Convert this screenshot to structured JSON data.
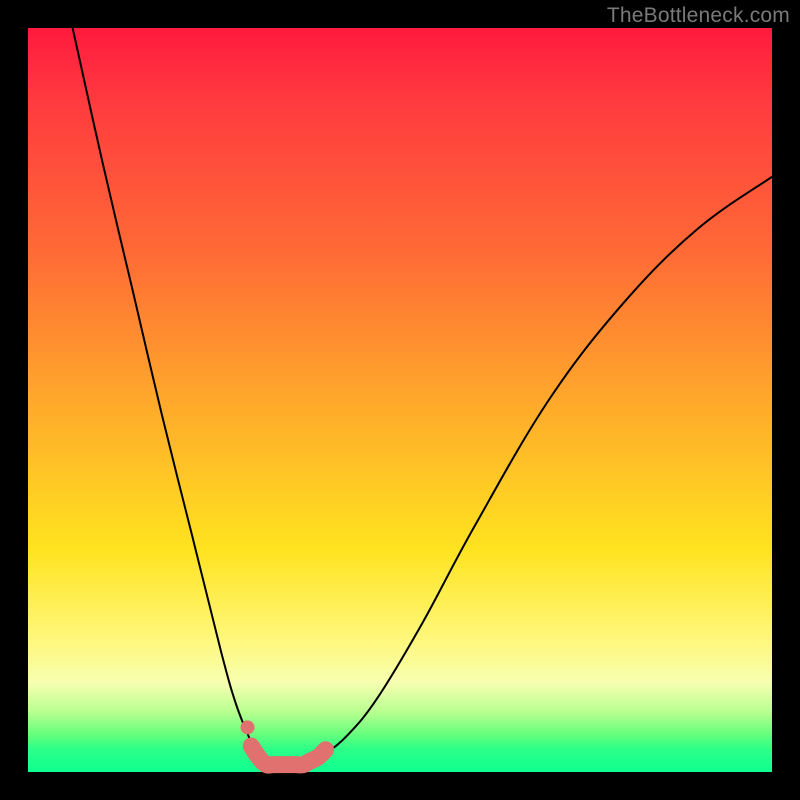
{
  "watermark": {
    "text": "TheBottleneck.com"
  },
  "chart_data": {
    "type": "line",
    "title": "",
    "xlabel": "",
    "ylabel": "",
    "xlim": [
      0,
      100
    ],
    "ylim": [
      0,
      100
    ],
    "series": [
      {
        "name": "black-curve",
        "x": [
          6,
          10,
          14,
          18,
          22,
          26,
          28,
          30,
          31,
          32,
          33,
          34,
          35,
          36,
          38,
          40,
          43,
          47,
          53,
          60,
          70,
          80,
          90,
          100
        ],
        "y": [
          100,
          82,
          65,
          48,
          32,
          16,
          9,
          4,
          2,
          1,
          1,
          1,
          1,
          1,
          1.5,
          2.5,
          5,
          10,
          20,
          33,
          50,
          63,
          73,
          80
        ]
      },
      {
        "name": "pink-highlight",
        "x": [
          30,
          31,
          32,
          33,
          34,
          35,
          36,
          37,
          38,
          39,
          40
        ],
        "y": [
          3.5,
          2,
          1,
          1,
          1,
          1,
          1,
          1,
          1.5,
          2,
          3
        ]
      },
      {
        "name": "pink-dot",
        "x": [
          29.5
        ],
        "y": [
          6
        ]
      }
    ],
    "colors": {
      "curve": "#000000",
      "highlight": "#e0716f",
      "gradient_top": "#ff1a3e",
      "gradient_mid": "#ffe31f",
      "gradient_bottom": "#0fff90"
    }
  }
}
